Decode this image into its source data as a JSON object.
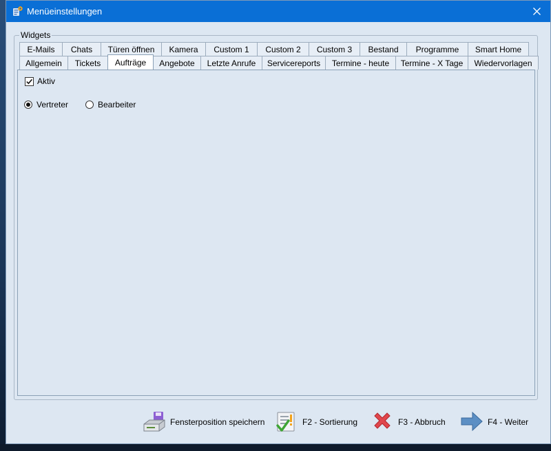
{
  "window": {
    "title": "Menüeinstellungen"
  },
  "group": {
    "label": "Widgets"
  },
  "tabs_top": [
    {
      "label": "E-Mails"
    },
    {
      "label": "Chats"
    },
    {
      "label": "Türen öffnen"
    },
    {
      "label": "Kamera"
    },
    {
      "label": "Custom 1"
    },
    {
      "label": "Custom 2"
    },
    {
      "label": "Custom 3"
    },
    {
      "label": "Bestand"
    },
    {
      "label": "Programme"
    },
    {
      "label": "Smart Home"
    }
  ],
  "tabs_bottom": [
    {
      "label": "Allgemein"
    },
    {
      "label": "Tickets"
    },
    {
      "label": "Aufträge",
      "active": true
    },
    {
      "label": "Angebote"
    },
    {
      "label": "Letzte Anrufe"
    },
    {
      "label": "Servicereports"
    },
    {
      "label": "Termine - heute"
    },
    {
      "label": "Termine - X Tage"
    },
    {
      "label": "Wiedervorlagen"
    }
  ],
  "panel": {
    "active_label": "Aktiv",
    "active_checked": true,
    "radio_options": [
      {
        "label": "Vertreter",
        "checked": true
      },
      {
        "label": "Bearbeiter",
        "checked": false
      }
    ]
  },
  "footer": {
    "save_position": "Fensterposition speichern",
    "sort": "F2 - Sortierung",
    "cancel": "F3 - Abbruch",
    "next": "F4 - Weiter"
  },
  "icons": {
    "app": "settings-app-icon",
    "close": "close-icon",
    "save": "floppy-drive-icon",
    "sort": "checklist-icon",
    "cancel": "red-x-icon",
    "next": "arrow-right-icon"
  },
  "colors": {
    "titlebar": "#0a6fd6",
    "window_bg": "#dde7f2",
    "active_tab": "#ffffff"
  }
}
